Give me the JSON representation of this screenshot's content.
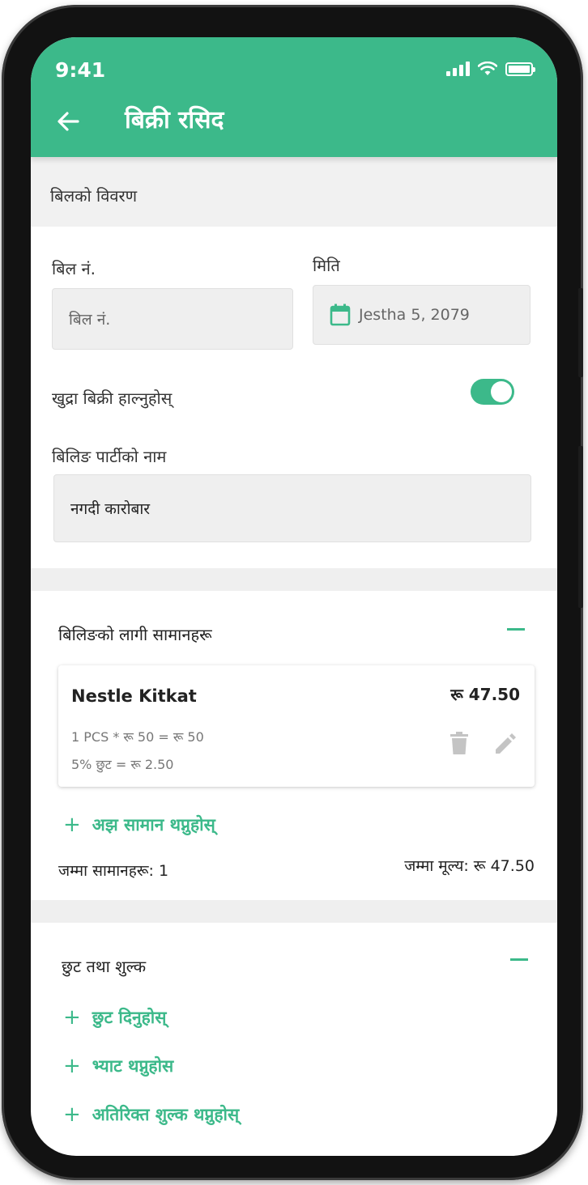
{
  "status_bar": {
    "time": "9:41"
  },
  "app_bar": {
    "title": "बिक्री रसिद"
  },
  "bill_details": {
    "header": "बिलको विवरण",
    "bill_no_label": "बिल नं.",
    "bill_no_placeholder": "बिल नं.",
    "date_label": "मिति",
    "date_value": "Jestha 5, 2079",
    "retail_toggle_label": "खुद्रा बिक्री हाल्नुहोस्",
    "retail_toggle_on": true,
    "party_label": "बिलिङ पार्टीको नाम",
    "party_value": "नगदी कारोबार"
  },
  "items_section": {
    "header": "बिलिङको लागी सामानहरू",
    "items": [
      {
        "name": "Nestle Kitkat",
        "price": "रू 47.50",
        "quantity_line": "1 PCS * रू 50 = रू 50",
        "discount_line": "5% छुट = रू 2.50"
      }
    ],
    "add_more_label": "अझ सामान थप्नुहोस्",
    "total_items": "जम्मा सामानहरू: 1",
    "total_amount": "जम्मा मूल्य: रू 47.50"
  },
  "charges_section": {
    "header": "छुट तथा शुल्क",
    "links": [
      "छुट दिनुहोस्",
      "भ्याट थप्नुहोस",
      "अतिरिक्त शुल्क थप्नुहोस्"
    ]
  },
  "colors": {
    "primary": "#3cb98a",
    "field_bg": "#efefef",
    "phone_frame": "#121212"
  }
}
